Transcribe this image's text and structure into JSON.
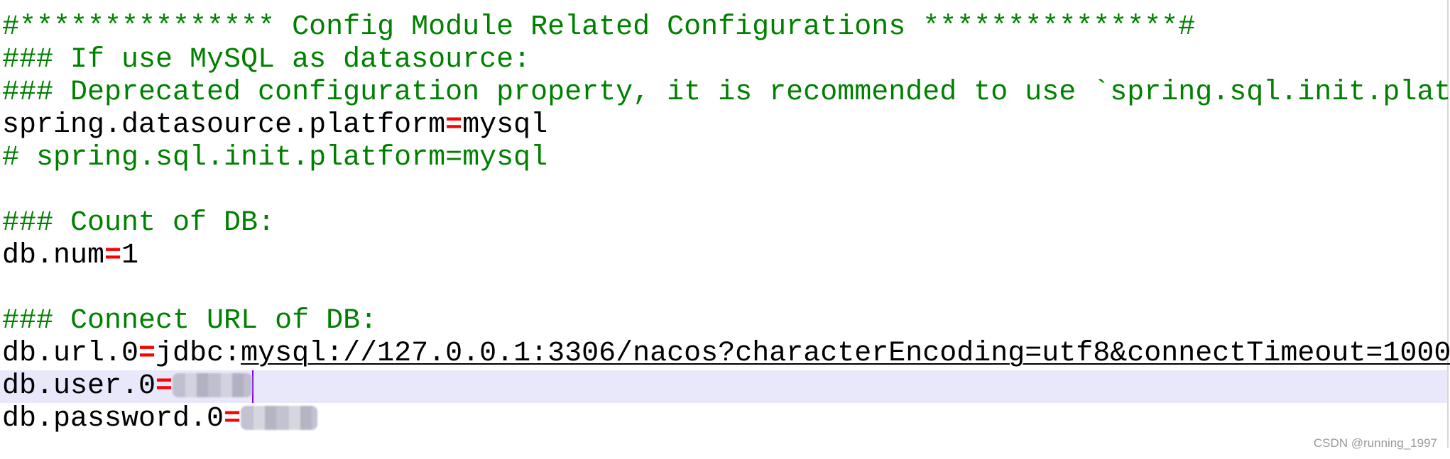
{
  "colors": {
    "comment": "#008000",
    "operator": "#ff0000",
    "current_line": "#e8e8fa",
    "text": "#000000"
  },
  "lines": [
    {
      "type": "comment",
      "text": "#*************** Config Module Related Configurations ***************#"
    },
    {
      "type": "comment",
      "text": "### If use MySQL as datasource:"
    },
    {
      "type": "comment",
      "text": "### Deprecated configuration property, it is recommended to use `spring.sql.init.plat"
    },
    {
      "type": "prop",
      "key": "spring.datasource.platform",
      "op": "=",
      "value": "mysql"
    },
    {
      "type": "comment",
      "text": "# spring.sql.init.platform=mysql"
    },
    {
      "type": "blank"
    },
    {
      "type": "comment",
      "text": "### Count of DB:"
    },
    {
      "type": "prop",
      "key": "db.num",
      "op": "=",
      "value": "1"
    },
    {
      "type": "blank"
    },
    {
      "type": "comment",
      "text": "### Connect URL of DB:"
    },
    {
      "type": "prop",
      "key": "db.url.0",
      "op": "=",
      "value_prefix": "jdbc:",
      "value_link": "mysql://127.0.0.1:3306/nacos?characterEncoding=utf8&connectTimeout=1000"
    },
    {
      "type": "prop",
      "key": "db.user.0",
      "op": "=",
      "masked": true,
      "current": true
    },
    {
      "type": "prop",
      "key": "db.password.0",
      "op": "=",
      "masked": true
    }
  ],
  "watermark": "CSDN @running_1997"
}
